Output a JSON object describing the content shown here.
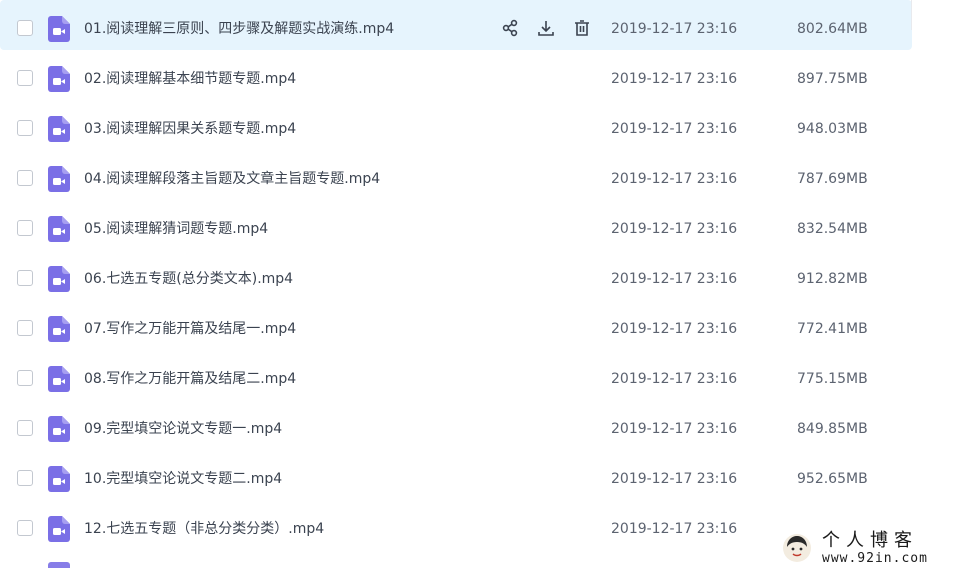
{
  "colors": {
    "hover_bg": "#e6f4fd",
    "video_icon": "#7a6fe6",
    "text": "#3b4350",
    "meta": "#5c6370"
  },
  "icons": {
    "file": "video-file-icon",
    "share": "share-icon",
    "download": "download-icon",
    "delete": "trash-icon"
  },
  "files": [
    {
      "name": "01.阅读理解三原则、四步骤及解题实战演练.mp4",
      "date": "2019-12-17 23:16",
      "size": "802.64MB"
    },
    {
      "name": "02.阅读理解基本细节题专题.mp4",
      "date": "2019-12-17 23:16",
      "size": "897.75MB"
    },
    {
      "name": "03.阅读理解因果关系题专题.mp4",
      "date": "2019-12-17 23:16",
      "size": "948.03MB"
    },
    {
      "name": "04.阅读理解段落主旨题及文章主旨题专题.mp4",
      "date": "2019-12-17 23:16",
      "size": "787.69MB"
    },
    {
      "name": "05.阅读理解猜词题专题.mp4",
      "date": "2019-12-17 23:16",
      "size": "832.54MB"
    },
    {
      "name": "06.七选五专题(总分类文本).mp4",
      "date": "2019-12-17 23:16",
      "size": "912.82MB"
    },
    {
      "name": "07.写作之万能开篇及结尾一.mp4",
      "date": "2019-12-17 23:16",
      "size": "772.41MB"
    },
    {
      "name": "08.写作之万能开篇及结尾二.mp4",
      "date": "2019-12-17 23:16",
      "size": "775.15MB"
    },
    {
      "name": "09.完型填空论说文专题一.mp4",
      "date": "2019-12-17 23:16",
      "size": "849.85MB"
    },
    {
      "name": "10.完型填空论说文专题二.mp4",
      "date": "2019-12-17 23:16",
      "size": "952.65MB"
    },
    {
      "name": "12.七选五专题（非总分类分类）.mp4",
      "date": "2019-12-17 23:16",
      "size": ""
    }
  ],
  "watermark": {
    "title": "个人博客",
    "url": "www.92in.com"
  }
}
